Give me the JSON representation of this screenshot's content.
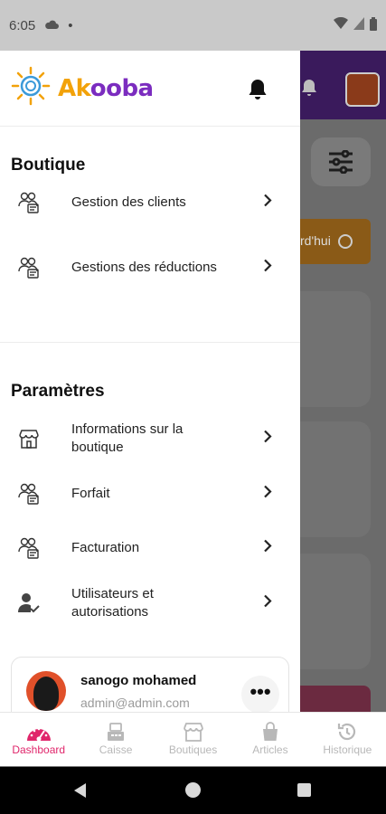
{
  "status_bar": {
    "time": "6:05"
  },
  "brand": {
    "name_part1": "Ak",
    "name_part2": "ooba"
  },
  "sections": {
    "boutique": {
      "title": "Boutique",
      "items": [
        {
          "label": "Gestion des clients",
          "icon": "users-list-icon"
        },
        {
          "label": "Gestions des réductions",
          "icon": "users-list-icon"
        }
      ]
    },
    "parametres": {
      "title": "Paramètres",
      "items": [
        {
          "label": "Informations sur la boutique",
          "icon": "store-icon"
        },
        {
          "label": "Forfait",
          "icon": "users-list-icon"
        },
        {
          "label": "Facturation",
          "icon": "users-list-icon"
        },
        {
          "label": "Utilisateurs et autorisations",
          "icon": "user-check-icon"
        }
      ]
    }
  },
  "user": {
    "name": "sanogo mohamed",
    "email": "admin@admin.com"
  },
  "background": {
    "orange_button_text": "rd'hui"
  },
  "bottom_nav": [
    {
      "label": "Dashboard",
      "icon": "dashboard-gauge-icon",
      "active": true
    },
    {
      "label": "Caisse",
      "icon": "register-icon",
      "active": false
    },
    {
      "label": "Boutiques",
      "icon": "store-icon",
      "active": false
    },
    {
      "label": "Articles",
      "icon": "bag-icon",
      "active": false
    },
    {
      "label": "Historique",
      "icon": "history-icon",
      "active": false
    }
  ],
  "colors": {
    "accent": "#e0266b",
    "brand_orange": "#f2a20a",
    "brand_purple": "#7b2cbf"
  }
}
